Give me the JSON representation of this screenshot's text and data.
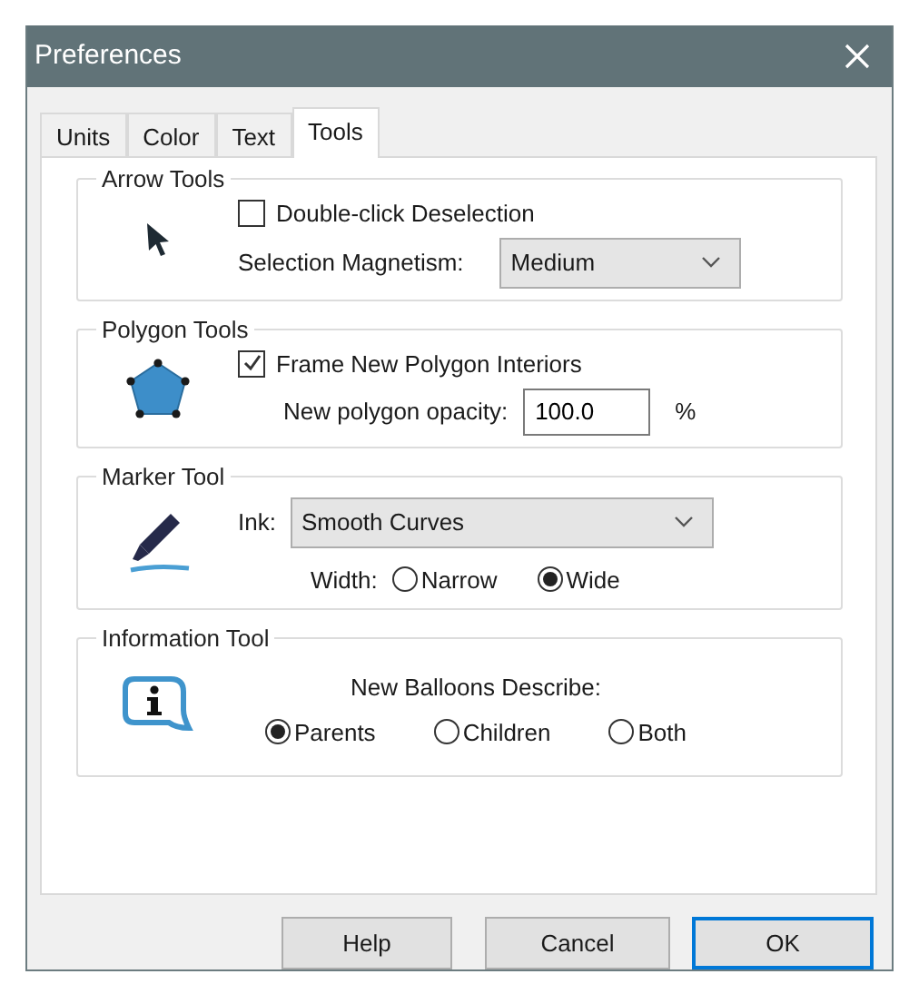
{
  "window": {
    "title": "Preferences"
  },
  "tabs": [
    {
      "label": "Units",
      "selected": false
    },
    {
      "label": "Color",
      "selected": false
    },
    {
      "label": "Text",
      "selected": false
    },
    {
      "label": "Tools",
      "selected": true
    }
  ],
  "groups": [
    {
      "title": "Arrow Tools",
      "kind": "arrow",
      "controls": [
        {
          "kind": "checkbox",
          "label": "Double-click Deselection",
          "checked": false
        },
        {
          "kind": "select",
          "label": "Selection Magnetism:",
          "value": "Medium"
        }
      ]
    },
    {
      "title": "Polygon Tools",
      "kind": "polygon",
      "controls": [
        {
          "kind": "checkbox",
          "label": "Frame New Polygon Interiors",
          "checked": true
        },
        {
          "kind": "field",
          "label": "New polygon opacity:",
          "value": "100.0",
          "unit": "%"
        }
      ]
    },
    {
      "title": "Marker Tool",
      "kind": "marker",
      "controls": [
        {
          "kind": "select",
          "label": "Ink:",
          "value": "Smooth Curves"
        },
        {
          "kind": "radios",
          "label": "Width:",
          "options": [
            {
              "label": "Narrow",
              "selected": false
            },
            {
              "label": "Wide",
              "selected": true
            }
          ]
        }
      ]
    },
    {
      "title": "Information Tool",
      "kind": "info",
      "controls": [
        {
          "kind": "choice",
          "label": "New Balloons Describe:",
          "options": [
            {
              "label": "Parents",
              "selected": true
            },
            {
              "label": "Children",
              "selected": false
            },
            {
              "label": "Both",
              "selected": false
            }
          ]
        }
      ]
    }
  ],
  "buttons": [
    {
      "label": "Help",
      "default": false
    },
    {
      "label": "Cancel",
      "default": false
    },
    {
      "label": "OK",
      "default": true
    }
  ]
}
